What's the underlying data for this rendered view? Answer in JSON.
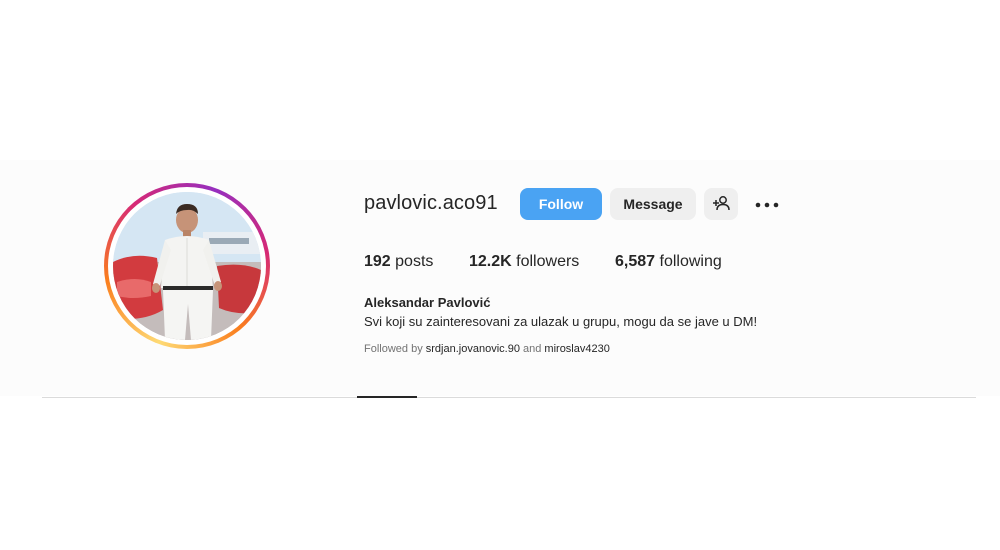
{
  "profile": {
    "username": "pavlovic.aco91",
    "full_name": "Aleksandar Pavlović",
    "bio": "Svi koji su zainteresovani za ulazak u grupu, mogu da se jave u DM!"
  },
  "actions": {
    "follow_label": "Follow",
    "message_label": "Message",
    "suggest_icon": "person-add-icon",
    "more_icon": "more-options-icon"
  },
  "stats": {
    "posts_count": "192",
    "posts_label": "posts",
    "followers_count": "12.2K",
    "followers_label": "followers",
    "following_count": "6,587",
    "following_label": "following"
  },
  "followed_by": {
    "prefix": "Followed by",
    "account_1": "srdjan.jovanovic.90",
    "conjunction": "and",
    "account_2": "miroslav4230"
  },
  "colors": {
    "follow_button": "#4aa3f3",
    "secondary_button": "#efefef",
    "text_primary": "#262626",
    "text_secondary": "#737373",
    "divider": "#dbdbdb"
  }
}
